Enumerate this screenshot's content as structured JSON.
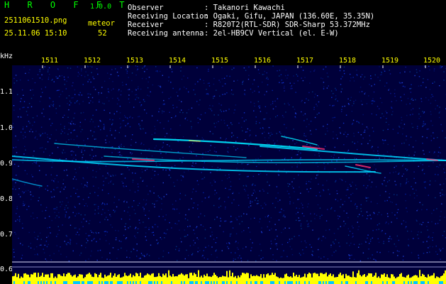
{
  "header": {
    "app_title": "H R O F F T",
    "version": "1.0.0",
    "filename": "2511061510.png",
    "datetime": "25.11.06 15:10",
    "meteor_label": "meteor",
    "meteor_count": "52",
    "observer_label": "Observer",
    "observer_value": ": Takanori Kawachi",
    "location_label": "Receiving Location",
    "location_value": ": Ogaki, Gifu, JAPAN (136.60E, 35.35N)",
    "receiver_label": "Receiver",
    "receiver_value": ": R820T2(RTL-SDR) SDR-Sharp 53.372MHz",
    "antenna_label": "Receiving antenna",
    "antenna_value": ": 2el-HB9CV Vertical (el. E-W)"
  },
  "axes": {
    "y_unit": "kHz",
    "y_ticks": [
      "1.1",
      "1.0",
      "0.9",
      "0.8",
      "0.7",
      "0.6"
    ],
    "x_ticks": [
      "1511",
      "1512",
      "1513",
      "1514",
      "1515",
      "1516",
      "1517",
      "1518",
      "1519",
      "1520"
    ]
  },
  "colors": {
    "background": "#000000",
    "noise_dark": "#00004a",
    "noise_light": "#1030c8",
    "trail_cyan": "#00e0ff",
    "trail_hot": "#ff3070",
    "power_bar": "#ffff00",
    "power_base": "#00c8ff"
  }
}
